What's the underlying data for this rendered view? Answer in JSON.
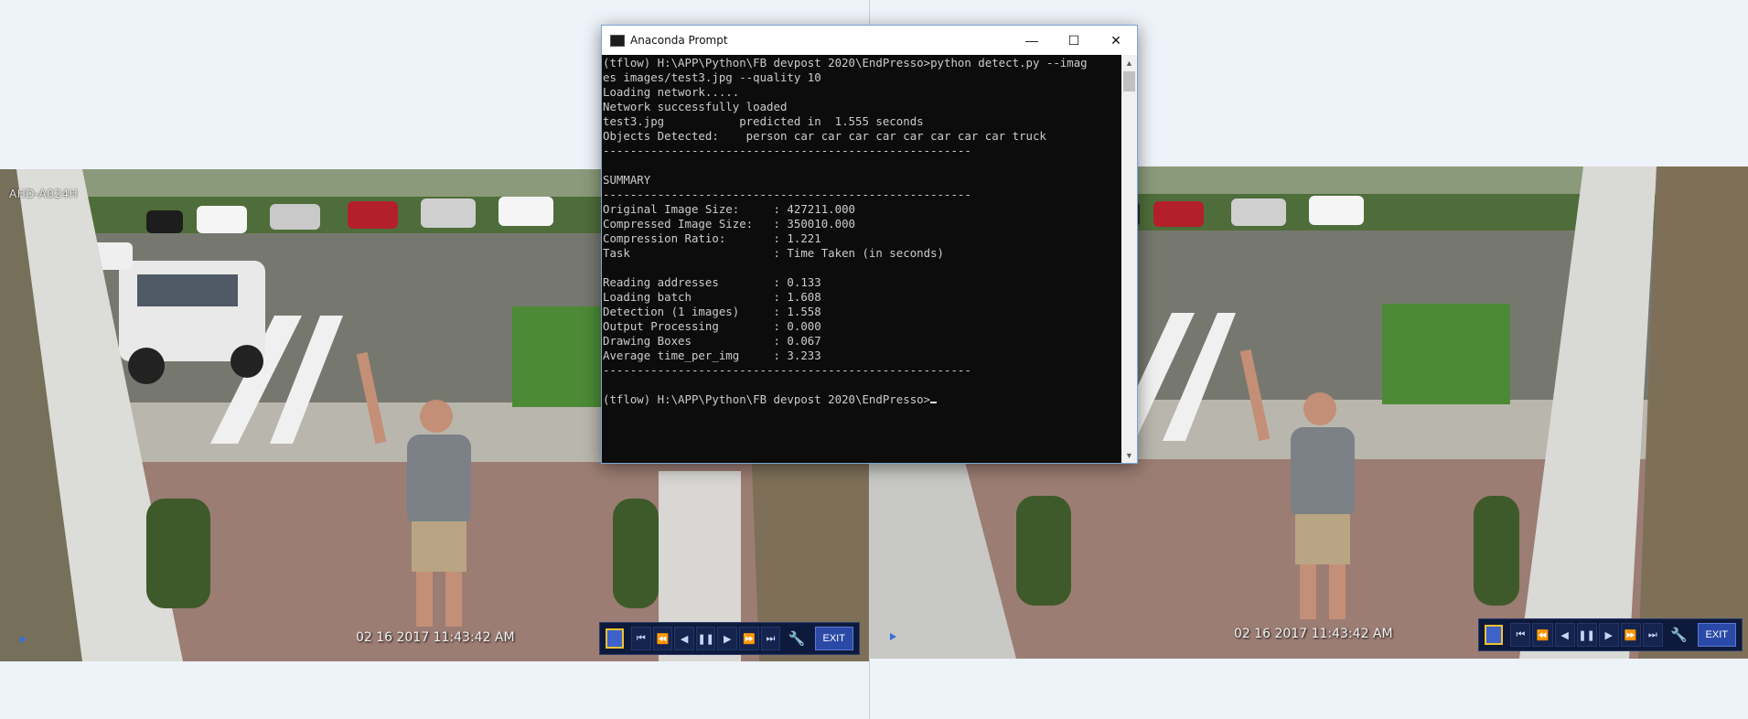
{
  "left_feed": {
    "camera_label": "AHD-A024H",
    "timestamp": "02 16 2017 11:43:42 AM"
  },
  "right_feed": {
    "timestamp": "02 16 2017 11:43:42 AM"
  },
  "dvr_controls": {
    "layout_icon": "layout-grid-icon",
    "buttons": [
      "skip-back-icon",
      "rewind-icon",
      "step-back-icon",
      "pause-icon",
      "step-forward-icon",
      "fast-forward-icon",
      "skip-forward-icon"
    ],
    "exit_label": "EXIT"
  },
  "window": {
    "title": "Anaconda Prompt",
    "minimize_glyph": "—",
    "maximize_glyph": "☐",
    "close_glyph": "✕"
  },
  "console": {
    "lines": [
      "(tflow) H:\\APP\\Python\\FB devpost 2020\\EndPresso>python detect.py --imag",
      "es images/test3.jpg --quality 10",
      "Loading network.....",
      "Network successfully loaded",
      "test3.jpg           predicted in  1.555 seconds",
      "Objects Detected:    person car car car car car car car car truck",
      "------------------------------------------------------",
      "",
      "SUMMARY",
      "------------------------------------------------------",
      "Original Image Size:     : 427211.000",
      "Compressed Image Size:   : 350010.000",
      "Compression Ratio:       : 1.221",
      "Task                     : Time Taken (in seconds)",
      "",
      "Reading addresses        : 0.133",
      "Loading batch            : 1.608",
      "Detection (1 images)     : 1.558",
      "Output Processing        : 0.000",
      "Drawing Boxes            : 0.067",
      "Average time_per_img     : 3.233",
      "------------------------------------------------------",
      "",
      "(tflow) H:\\APP\\Python\\FB devpost 2020\\EndPresso>"
    ]
  }
}
